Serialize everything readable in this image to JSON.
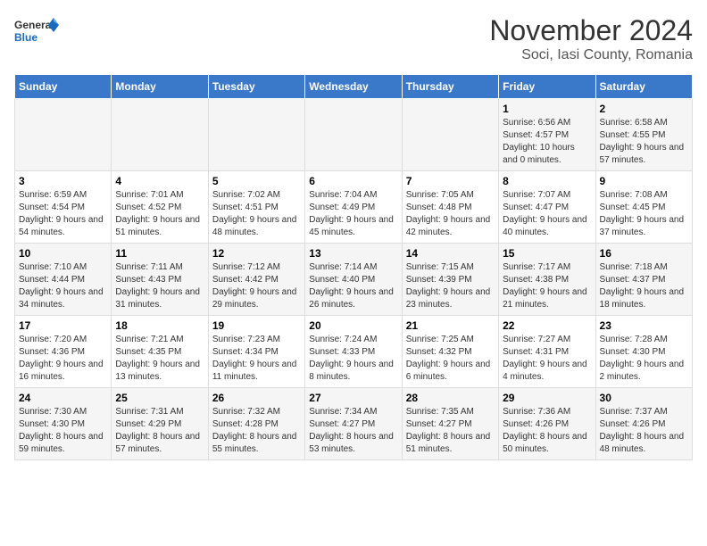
{
  "logo": {
    "line1": "General",
    "line2": "Blue"
  },
  "title": "November 2024",
  "subtitle": "Soci, Iasi County, Romania",
  "days_of_week": [
    "Sunday",
    "Monday",
    "Tuesday",
    "Wednesday",
    "Thursday",
    "Friday",
    "Saturday"
  ],
  "weeks": [
    [
      {
        "day": "",
        "info": ""
      },
      {
        "day": "",
        "info": ""
      },
      {
        "day": "",
        "info": ""
      },
      {
        "day": "",
        "info": ""
      },
      {
        "day": "",
        "info": ""
      },
      {
        "day": "1",
        "info": "Sunrise: 6:56 AM\nSunset: 4:57 PM\nDaylight: 10 hours and 0 minutes."
      },
      {
        "day": "2",
        "info": "Sunrise: 6:58 AM\nSunset: 4:55 PM\nDaylight: 9 hours and 57 minutes."
      }
    ],
    [
      {
        "day": "3",
        "info": "Sunrise: 6:59 AM\nSunset: 4:54 PM\nDaylight: 9 hours and 54 minutes."
      },
      {
        "day": "4",
        "info": "Sunrise: 7:01 AM\nSunset: 4:52 PM\nDaylight: 9 hours and 51 minutes."
      },
      {
        "day": "5",
        "info": "Sunrise: 7:02 AM\nSunset: 4:51 PM\nDaylight: 9 hours and 48 minutes."
      },
      {
        "day": "6",
        "info": "Sunrise: 7:04 AM\nSunset: 4:49 PM\nDaylight: 9 hours and 45 minutes."
      },
      {
        "day": "7",
        "info": "Sunrise: 7:05 AM\nSunset: 4:48 PM\nDaylight: 9 hours and 42 minutes."
      },
      {
        "day": "8",
        "info": "Sunrise: 7:07 AM\nSunset: 4:47 PM\nDaylight: 9 hours and 40 minutes."
      },
      {
        "day": "9",
        "info": "Sunrise: 7:08 AM\nSunset: 4:45 PM\nDaylight: 9 hours and 37 minutes."
      }
    ],
    [
      {
        "day": "10",
        "info": "Sunrise: 7:10 AM\nSunset: 4:44 PM\nDaylight: 9 hours and 34 minutes."
      },
      {
        "day": "11",
        "info": "Sunrise: 7:11 AM\nSunset: 4:43 PM\nDaylight: 9 hours and 31 minutes."
      },
      {
        "day": "12",
        "info": "Sunrise: 7:12 AM\nSunset: 4:42 PM\nDaylight: 9 hours and 29 minutes."
      },
      {
        "day": "13",
        "info": "Sunrise: 7:14 AM\nSunset: 4:40 PM\nDaylight: 9 hours and 26 minutes."
      },
      {
        "day": "14",
        "info": "Sunrise: 7:15 AM\nSunset: 4:39 PM\nDaylight: 9 hours and 23 minutes."
      },
      {
        "day": "15",
        "info": "Sunrise: 7:17 AM\nSunset: 4:38 PM\nDaylight: 9 hours and 21 minutes."
      },
      {
        "day": "16",
        "info": "Sunrise: 7:18 AM\nSunset: 4:37 PM\nDaylight: 9 hours and 18 minutes."
      }
    ],
    [
      {
        "day": "17",
        "info": "Sunrise: 7:20 AM\nSunset: 4:36 PM\nDaylight: 9 hours and 16 minutes."
      },
      {
        "day": "18",
        "info": "Sunrise: 7:21 AM\nSunset: 4:35 PM\nDaylight: 9 hours and 13 minutes."
      },
      {
        "day": "19",
        "info": "Sunrise: 7:23 AM\nSunset: 4:34 PM\nDaylight: 9 hours and 11 minutes."
      },
      {
        "day": "20",
        "info": "Sunrise: 7:24 AM\nSunset: 4:33 PM\nDaylight: 9 hours and 8 minutes."
      },
      {
        "day": "21",
        "info": "Sunrise: 7:25 AM\nSunset: 4:32 PM\nDaylight: 9 hours and 6 minutes."
      },
      {
        "day": "22",
        "info": "Sunrise: 7:27 AM\nSunset: 4:31 PM\nDaylight: 9 hours and 4 minutes."
      },
      {
        "day": "23",
        "info": "Sunrise: 7:28 AM\nSunset: 4:30 PM\nDaylight: 9 hours and 2 minutes."
      }
    ],
    [
      {
        "day": "24",
        "info": "Sunrise: 7:30 AM\nSunset: 4:30 PM\nDaylight: 8 hours and 59 minutes."
      },
      {
        "day": "25",
        "info": "Sunrise: 7:31 AM\nSunset: 4:29 PM\nDaylight: 8 hours and 57 minutes."
      },
      {
        "day": "26",
        "info": "Sunrise: 7:32 AM\nSunset: 4:28 PM\nDaylight: 8 hours and 55 minutes."
      },
      {
        "day": "27",
        "info": "Sunrise: 7:34 AM\nSunset: 4:27 PM\nDaylight: 8 hours and 53 minutes."
      },
      {
        "day": "28",
        "info": "Sunrise: 7:35 AM\nSunset: 4:27 PM\nDaylight: 8 hours and 51 minutes."
      },
      {
        "day": "29",
        "info": "Sunrise: 7:36 AM\nSunset: 4:26 PM\nDaylight: 8 hours and 50 minutes."
      },
      {
        "day": "30",
        "info": "Sunrise: 7:37 AM\nSunset: 4:26 PM\nDaylight: 8 hours and 48 minutes."
      }
    ]
  ]
}
